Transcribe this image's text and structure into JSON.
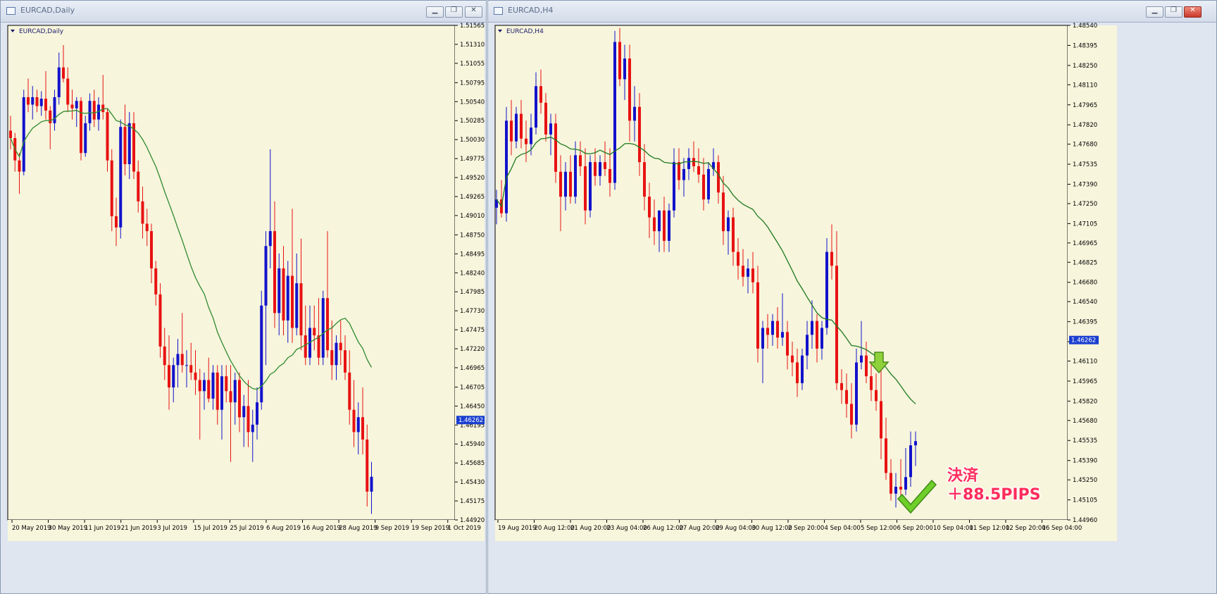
{
  "windows": [
    {
      "title": "EURCAD,Daily",
      "chart_label": "EURCAD,Daily"
    },
    {
      "title": "EURCAD,H4",
      "chart_label": "EURCAD,H4"
    }
  ],
  "icons": {
    "minimize": "minimize-icon",
    "maximize": "restore-icon",
    "close": "close-icon"
  },
  "colors": {
    "background": "#f7f5dc",
    "bull": "#1212cc",
    "bear": "#e81212",
    "ma_daily": "#2f8a2f",
    "ma_h4": "#1e7a1e",
    "price_tag": "#1a3ed0"
  },
  "annotation": {
    "line1": "決済",
    "line2": "＋88.5PIPS"
  },
  "chart_data": [
    {
      "type": "candlestick",
      "title": "EURCAD,Daily",
      "symbol": "EURCAD",
      "timeframe": "Daily",
      "current_price": "1.46262",
      "y_ticks": [
        "1.51565",
        "1.51310",
        "1.51055",
        "1.50795",
        "1.50540",
        "1.50285",
        "1.50030",
        "1.49775",
        "1.49520",
        "1.49265",
        "1.49010",
        "1.48750",
        "1.48495",
        "1.48240",
        "1.47985",
        "1.47730",
        "1.47475",
        "1.47220",
        "1.46965",
        "1.46705",
        "1.46450",
        "1.46195",
        "1.45940",
        "1.45685",
        "1.45430",
        "1.45175",
        "1.44920"
      ],
      "ylim": [
        1.4492,
        1.51565
      ],
      "x_ticks": [
        "20 May 2019",
        "30 May 2019",
        "11 Jun 2019",
        "21 Jun 2019",
        "3 Jul 2019",
        "15 Jul 2019",
        "25 Jul 2019",
        "6 Aug 2019",
        "16 Aug 2019",
        "28 Aug 2019",
        "9 Sep 2019",
        "19 Sep 2019",
        "1 Oct 2019"
      ],
      "candles_ohlc": [
        [
          1.5015,
          1.5035,
          1.499,
          1.5005
        ],
        [
          1.5005,
          1.5012,
          1.496,
          1.4975
        ],
        [
          1.4975,
          1.4985,
          1.493,
          1.496
        ],
        [
          1.496,
          1.507,
          1.4955,
          1.506
        ],
        [
          1.506,
          1.5085,
          1.504,
          1.505
        ],
        [
          1.505,
          1.5075,
          1.503,
          1.506
        ],
        [
          1.506,
          1.507,
          1.504,
          1.5048
        ],
        [
          1.5048,
          1.5068,
          1.5035,
          1.5058
        ],
        [
          1.5058,
          1.5095,
          1.503,
          1.5042
        ],
        [
          1.5042,
          1.5048,
          1.499,
          1.5025
        ],
        [
          1.5025,
          1.507,
          1.5015,
          1.506
        ],
        [
          1.506,
          1.512,
          1.505,
          1.51
        ],
        [
          1.51,
          1.513,
          1.508,
          1.5085
        ],
        [
          1.5085,
          1.51,
          1.504,
          1.505
        ],
        [
          1.505,
          1.507,
          1.503,
          1.5045
        ],
        [
          1.5045,
          1.506,
          1.502,
          1.5055
        ],
        [
          1.5055,
          1.506,
          1.4975,
          1.4985
        ],
        [
          1.4985,
          1.5035,
          1.498,
          1.5025
        ],
        [
          1.5025,
          1.5065,
          1.5015,
          1.5055
        ],
        [
          1.5055,
          1.507,
          1.502,
          1.503
        ],
        [
          1.503,
          1.506,
          1.5015,
          1.505
        ],
        [
          1.505,
          1.509,
          1.503,
          1.504
        ],
        [
          1.504,
          1.5045,
          1.496,
          1.4975
        ],
        [
          1.4975,
          1.499,
          1.488,
          1.49
        ],
        [
          1.49,
          1.4925,
          1.486,
          1.4885
        ],
        [
          1.4885,
          1.503,
          1.487,
          1.502
        ],
        [
          1.502,
          1.505,
          1.4955,
          1.497
        ],
        [
          1.497,
          1.504,
          1.495,
          1.5025
        ],
        [
          1.5025,
          1.504,
          1.495,
          1.496
        ],
        [
          1.496,
          1.4975,
          1.4905,
          1.492
        ],
        [
          1.492,
          1.494,
          1.487,
          1.489
        ],
        [
          1.489,
          1.491,
          1.486,
          1.488
        ],
        [
          1.488,
          1.489,
          1.481,
          1.483
        ],
        [
          1.483,
          1.484,
          1.478,
          1.4795
        ],
        [
          1.4795,
          1.481,
          1.471,
          1.4725
        ],
        [
          1.4725,
          1.475,
          1.468,
          1.47
        ],
        [
          1.47,
          1.474,
          1.464,
          1.467
        ],
        [
          1.467,
          1.471,
          1.465,
          1.47
        ],
        [
          1.47,
          1.4735,
          1.467,
          1.4715
        ],
        [
          1.4715,
          1.477,
          1.469,
          1.47
        ],
        [
          1.47,
          1.472,
          1.467,
          1.47
        ],
        [
          1.47,
          1.473,
          1.468,
          1.469
        ],
        [
          1.469,
          1.472,
          1.466,
          1.468
        ],
        [
          1.468,
          1.4695,
          1.46,
          1.4665
        ],
        [
          1.4665,
          1.469,
          1.464,
          1.468
        ],
        [
          1.468,
          1.471,
          1.465,
          1.4655
        ],
        [
          1.4655,
          1.47,
          1.464,
          1.469
        ],
        [
          1.469,
          1.47,
          1.462,
          1.464
        ],
        [
          1.464,
          1.47,
          1.46,
          1.4685
        ],
        [
          1.4685,
          1.47,
          1.465,
          1.4665
        ],
        [
          1.4665,
          1.47,
          1.457,
          1.465
        ],
        [
          1.465,
          1.469,
          1.462,
          1.468
        ],
        [
          1.468,
          1.469,
          1.461,
          1.463
        ],
        [
          1.463,
          1.466,
          1.459,
          1.4645
        ],
        [
          1.4645,
          1.468,
          1.459,
          1.461
        ],
        [
          1.461,
          1.464,
          1.457,
          1.462
        ],
        [
          1.462,
          1.467,
          1.46,
          1.465
        ],
        [
          1.465,
          1.48,
          1.464,
          1.478
        ],
        [
          1.478,
          1.488,
          1.47,
          1.486
        ],
        [
          1.486,
          1.499,
          1.483,
          1.488
        ],
        [
          1.488,
          1.492,
          1.475,
          1.477
        ],
        [
          1.477,
          1.485,
          1.474,
          1.483
        ],
        [
          1.483,
          1.486,
          1.474,
          1.476
        ],
        [
          1.476,
          1.484,
          1.473,
          1.482
        ],
        [
          1.482,
          1.491,
          1.473,
          1.475
        ],
        [
          1.475,
          1.485,
          1.474,
          1.481
        ],
        [
          1.481,
          1.487,
          1.472,
          1.474
        ],
        [
          1.474,
          1.478,
          1.47,
          1.471
        ],
        [
          1.471,
          1.478,
          1.47,
          1.475
        ],
        [
          1.475,
          1.478,
          1.472,
          1.474
        ],
        [
          1.474,
          1.479,
          1.47,
          1.471
        ],
        [
          1.471,
          1.48,
          1.47,
          1.479
        ],
        [
          1.479,
          1.488,
          1.471,
          1.472
        ],
        [
          1.472,
          1.476,
          1.468,
          1.47
        ],
        [
          1.47,
          1.474,
          1.468,
          1.473
        ],
        [
          1.473,
          1.476,
          1.47,
          1.472
        ],
        [
          1.472,
          1.474,
          1.468,
          1.469
        ],
        [
          1.469,
          1.472,
          1.462,
          1.464
        ],
        [
          1.464,
          1.468,
          1.459,
          1.461
        ],
        [
          1.461,
          1.465,
          1.458,
          1.463
        ],
        [
          1.463,
          1.467,
          1.458,
          1.46
        ],
        [
          1.46,
          1.462,
          1.451,
          1.453
        ],
        [
          1.453,
          1.457,
          1.45,
          1.455
        ]
      ]
    },
    {
      "type": "candlestick",
      "title": "EURCAD,H4",
      "symbol": "EURCAD",
      "timeframe": "H4",
      "current_price": "1.46262",
      "y_ticks": [
        "1.48540",
        "1.48395",
        "1.48250",
        "1.48110",
        "1.47965",
        "1.47820",
        "1.47680",
        "1.47535",
        "1.47390",
        "1.47250",
        "1.47105",
        "1.46965",
        "1.46825",
        "1.46680",
        "1.46540",
        "1.46395",
        "1.46250",
        "1.46110",
        "1.45965",
        "1.45820",
        "1.45680",
        "1.45535",
        "1.45390",
        "1.45250",
        "1.45105",
        "1.44960"
      ],
      "ylim": [
        1.4496,
        1.4854
      ],
      "x_ticks": [
        "19 Aug 2019",
        "20 Aug 12:00",
        "21 Aug 20:00",
        "23 Aug 04:00",
        "26 Aug 12:00",
        "27 Aug 20:00",
        "29 Aug 04:00",
        "30 Aug 12:00",
        "2 Sep 20:00",
        "4 Sep 04:00",
        "5 Sep 12:00",
        "6 Sep 20:00",
        "10 Sep 04:00",
        "11 Sep 12:00",
        "12 Sep 20:00",
        "16 Sep 04:00"
      ],
      "candles_ohlc": [
        [
          1.4722,
          1.4735,
          1.471,
          1.4728
        ],
        [
          1.4728,
          1.4742,
          1.4715,
          1.4718
        ],
        [
          1.4718,
          1.4795,
          1.4712,
          1.4785
        ],
        [
          1.4785,
          1.48,
          1.476,
          1.477
        ],
        [
          1.477,
          1.4795,
          1.4765,
          1.479
        ],
        [
          1.479,
          1.48,
          1.4765,
          1.4772
        ],
        [
          1.4772,
          1.4785,
          1.4755,
          1.4768
        ],
        [
          1.4768,
          1.479,
          1.476,
          1.478
        ],
        [
          1.478,
          1.482,
          1.4775,
          1.481
        ],
        [
          1.481,
          1.4822,
          1.479,
          1.4798
        ],
        [
          1.4798,
          1.4805,
          1.477,
          1.4775
        ],
        [
          1.4775,
          1.479,
          1.476,
          1.4783
        ],
        [
          1.4783,
          1.479,
          1.474,
          1.4748
        ],
        [
          1.4748,
          1.476,
          1.4705,
          1.473
        ],
        [
          1.473,
          1.4755,
          1.472,
          1.4748
        ],
        [
          1.4748,
          1.476,
          1.4725,
          1.473
        ],
        [
          1.473,
          1.477,
          1.4725,
          1.476
        ],
        [
          1.476,
          1.477,
          1.4745,
          1.4752
        ],
        [
          1.4752,
          1.4765,
          1.471,
          1.472
        ],
        [
          1.472,
          1.476,
          1.4715,
          1.4755
        ],
        [
          1.4755,
          1.4765,
          1.4738,
          1.4745
        ],
        [
          1.4745,
          1.476,
          1.4738,
          1.4755
        ],
        [
          1.4755,
          1.477,
          1.4745,
          1.475
        ],
        [
          1.475,
          1.4765,
          1.473,
          1.474
        ],
        [
          1.474,
          1.485,
          1.4735,
          1.4842
        ],
        [
          1.4842,
          1.4852,
          1.481,
          1.4815
        ],
        [
          1.4815,
          1.484,
          1.48,
          1.483
        ],
        [
          1.483,
          1.484,
          1.477,
          1.4785
        ],
        [
          1.4785,
          1.481,
          1.477,
          1.4795
        ],
        [
          1.4795,
          1.4805,
          1.4745,
          1.4755
        ],
        [
          1.4755,
          1.4768,
          1.472,
          1.473
        ],
        [
          1.473,
          1.474,
          1.47,
          1.4715
        ],
        [
          1.4715,
          1.4728,
          1.4695,
          1.4705
        ],
        [
          1.4705,
          1.472,
          1.469,
          1.472
        ],
        [
          1.472,
          1.473,
          1.469,
          1.4698
        ],
        [
          1.4698,
          1.4725,
          1.469,
          1.472
        ],
        [
          1.472,
          1.4765,
          1.4715,
          1.4755
        ],
        [
          1.4755,
          1.4765,
          1.4735,
          1.4742
        ],
        [
          1.4742,
          1.4758,
          1.473,
          1.475
        ],
        [
          1.475,
          1.4765,
          1.4742,
          1.4758
        ],
        [
          1.4758,
          1.477,
          1.4748,
          1.4752
        ],
        [
          1.4752,
          1.4765,
          1.474,
          1.4746
        ],
        [
          1.4746,
          1.4758,
          1.472,
          1.4728
        ],
        [
          1.4728,
          1.4755,
          1.4725,
          1.475
        ],
        [
          1.475,
          1.4765,
          1.4745,
          1.4755
        ],
        [
          1.4755,
          1.476,
          1.4725,
          1.4733
        ],
        [
          1.4733,
          1.4745,
          1.4695,
          1.4705
        ],
        [
          1.4705,
          1.472,
          1.4688,
          1.4715
        ],
        [
          1.4715,
          1.4722,
          1.468,
          1.469
        ],
        [
          1.469,
          1.47,
          1.467,
          1.468
        ],
        [
          1.468,
          1.4692,
          1.4665,
          1.4672
        ],
        [
          1.4672,
          1.4685,
          1.466,
          1.4678
        ],
        [
          1.4678,
          1.469,
          1.466,
          1.4668
        ],
        [
          1.4668,
          1.468,
          1.461,
          1.462
        ],
        [
          1.462,
          1.464,
          1.4595,
          1.4635
        ],
        [
          1.4635,
          1.4645,
          1.462,
          1.463
        ],
        [
          1.463,
          1.4645,
          1.4622,
          1.464
        ],
        [
          1.464,
          1.465,
          1.462,
          1.4628
        ],
        [
          1.4628,
          1.466,
          1.4622,
          1.4632
        ],
        [
          1.4632,
          1.464,
          1.4605,
          1.4615
        ],
        [
          1.4615,
          1.4625,
          1.46,
          1.461
        ],
        [
          1.461,
          1.462,
          1.4585,
          1.4595
        ],
        [
          1.4595,
          1.462,
          1.459,
          1.4615
        ],
        [
          1.4615,
          1.464,
          1.4605,
          1.463
        ],
        [
          1.463,
          1.4655,
          1.462,
          1.464
        ],
        [
          1.464,
          1.4645,
          1.461,
          1.462
        ],
        [
          1.462,
          1.464,
          1.4612,
          1.4635
        ],
        [
          1.4635,
          1.47,
          1.463,
          1.469
        ],
        [
          1.469,
          1.471,
          1.467,
          1.468
        ],
        [
          1.468,
          1.4705,
          1.459,
          1.4595
        ],
        [
          1.4595,
          1.4605,
          1.458,
          1.459
        ],
        [
          1.459,
          1.4602,
          1.457,
          1.458
        ],
        [
          1.458,
          1.4595,
          1.4555,
          1.4565
        ],
        [
          1.4565,
          1.462,
          1.456,
          1.461
        ],
        [
          1.461,
          1.464,
          1.4605,
          1.4615
        ],
        [
          1.4615,
          1.4625,
          1.4595,
          1.46
        ],
        [
          1.46,
          1.461,
          1.4582,
          1.459
        ],
        [
          1.459,
          1.4602,
          1.4575,
          1.4582
        ],
        [
          1.4582,
          1.461,
          1.454,
          1.4555
        ],
        [
          1.4555,
          1.457,
          1.4525,
          1.453
        ],
        [
          1.453,
          1.454,
          1.451,
          1.4515
        ],
        [
          1.4515,
          1.453,
          1.4505,
          1.452
        ],
        [
          1.452,
          1.454,
          1.4512,
          1.4518
        ],
        [
          1.4518,
          1.4548,
          1.4514,
          1.4527
        ],
        [
          1.4527,
          1.456,
          1.452,
          1.455
        ],
        [
          1.455,
          1.456,
          1.4535,
          1.4553
        ]
      ]
    }
  ]
}
